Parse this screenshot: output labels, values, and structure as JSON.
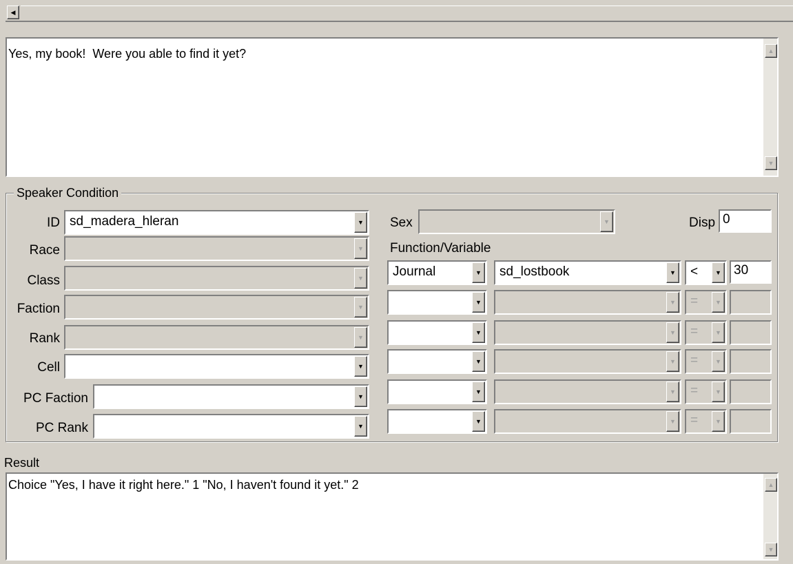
{
  "dialogue_text": "Yes, my book!  Were you able to find it yet?",
  "speaker_condition": {
    "title": "Speaker Condition",
    "id_label": "ID",
    "id_value": "sd_madera_hleran",
    "race_label": "Race",
    "class_label": "Class",
    "faction_label": "Faction",
    "rank_label": "Rank",
    "cell_label": "Cell",
    "pc_faction_label": "PC Faction",
    "pc_rank_label": "PC Rank",
    "sex_label": "Sex",
    "disp_label": "Disp",
    "disp_value": "0",
    "function_variable_label": "Function/Variable",
    "rows": [
      {
        "function": "Journal",
        "variable": "sd_lostbook",
        "operator": "<",
        "value": "30"
      },
      {
        "function": "",
        "variable": "",
        "operator": "=",
        "value": ""
      },
      {
        "function": "",
        "variable": "",
        "operator": "=",
        "value": ""
      },
      {
        "function": "",
        "variable": "",
        "operator": "=",
        "value": ""
      },
      {
        "function": "",
        "variable": "",
        "operator": "=",
        "value": ""
      },
      {
        "function": "",
        "variable": "",
        "operator": "=",
        "value": ""
      }
    ]
  },
  "result": {
    "label": "Result",
    "text": "Choice \"Yes, I have it right here.\" 1 \"No, I haven't found it yet.\" 2"
  },
  "icons": {
    "scroll_left": "scroll-left-arrow-icon",
    "scroll_up": "scroll-up-arrow-icon",
    "scroll_down": "scroll-down-arrow-icon",
    "dropdown": "dropdown-arrow-icon"
  }
}
